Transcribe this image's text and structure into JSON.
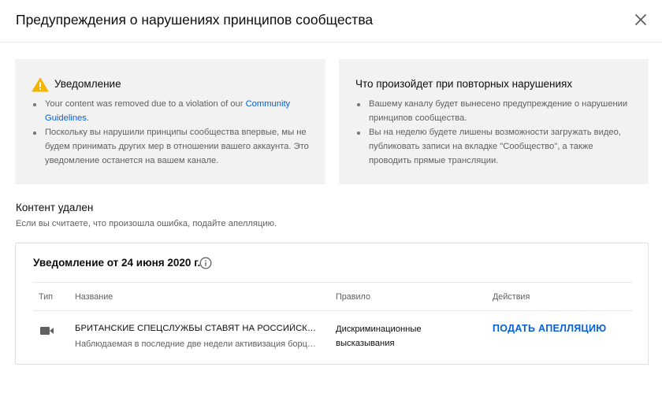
{
  "dialog": {
    "title": "Предупреждения о нарушениях принципов сообщества",
    "close_icon": "close-icon"
  },
  "notice_card": {
    "icon": "warning-icon",
    "icon_color": "#f4b400",
    "title": "Уведомление",
    "item1_text": "Your content was removed due to a violation of our ",
    "item1_link": "Community Guidelines",
    "item1_suffix": ".",
    "item2": "Поскольку вы нарушили принципы сообщества впервые, мы не будем принимать других мер в отношении вашего аккаунта. Это уведомление останется на вашем канале."
  },
  "repeat_card": {
    "title": "Что произойдет при повторных нарушениях",
    "items": [
      "Вашему каналу будет вынесено предупреждение о нарушении принципов сообщества.",
      "Вы на неделю будете лишены возможности загружать видео, публиковать записи на вкладке \"Сообщество\", а также проводить прямые трансляции."
    ]
  },
  "content_removed": {
    "title": "Контент удален",
    "subtitle": "Если вы считаете, что произошла ошибка, подайте апелляцию."
  },
  "strike": {
    "title": "Уведомление от 24 июня 2020 г.",
    "info_icon": "info-icon",
    "columns": {
      "type": "Тип",
      "name": "Название",
      "rule": "Правило",
      "actions": "Действия"
    },
    "row": {
      "type_icon": "video-camera-icon",
      "title": "БРИТАНСКИЕ СПЕЦСЛУЖБЫ СТАВЯТ НА РОССИЙСКИХ СПОРТСМЕНОВ",
      "description": "Наблюдаемая в последние две недели активизация борцов с допингом",
      "rule": "Дискриминационные высказывания",
      "action": "ПОДАТЬ АПЕЛЛЯЦИЮ"
    }
  },
  "colors": {
    "link": "#065fd4",
    "card_bg": "#f2f2f2",
    "secondary_text": "#606060"
  }
}
